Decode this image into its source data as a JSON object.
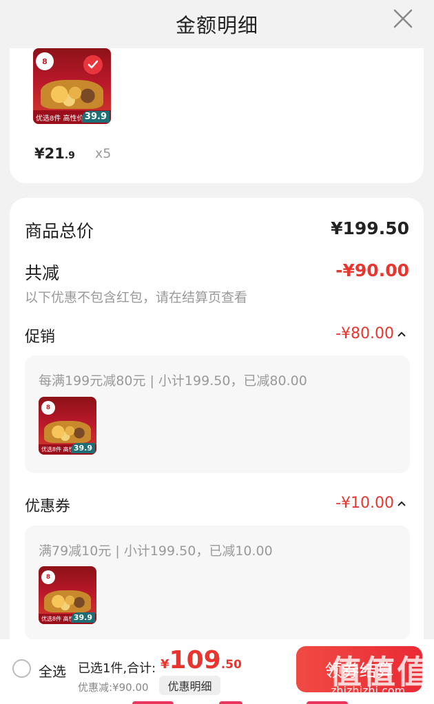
{
  "header": {
    "title": "金额明细"
  },
  "product": {
    "price_main": "¥21",
    "price_decimal": ".9",
    "quantity": "x5",
    "thumb_badge": "8",
    "thumb_strip": "优选8件 高性价比",
    "thumb_price": "39.9"
  },
  "summary": {
    "total_label": "商品总价",
    "total_value": "¥199.50",
    "reduce_label": "共减",
    "reduce_value": "-¥90.00",
    "note": "以下优惠不包含红包，请在结算页查看"
  },
  "promotion": {
    "label": "促销",
    "value": "-¥80.00",
    "desc": "每满199元减80元 | 小计199.50，已减80.00"
  },
  "coupon": {
    "label": "优惠券",
    "value": "-¥10.00",
    "desc": "满79减10元 | 小计199.50，已减10.00"
  },
  "bottom": {
    "select_all": "全选",
    "selected_text": "已选1件,合计:",
    "currency": "¥",
    "total_int": "109",
    "total_dec": ".50",
    "discount_text": "优惠减:¥90.00",
    "detail_button": "优惠明细",
    "checkout_button": "领券结算",
    "watermark_big": "值值值",
    "watermark_small": "zhizhizhi.com"
  },
  "colors": {
    "accent": "#e8362f",
    "checkout_gradient_start": "#f04a43",
    "checkout_gradient_end": "#ea2a35"
  }
}
